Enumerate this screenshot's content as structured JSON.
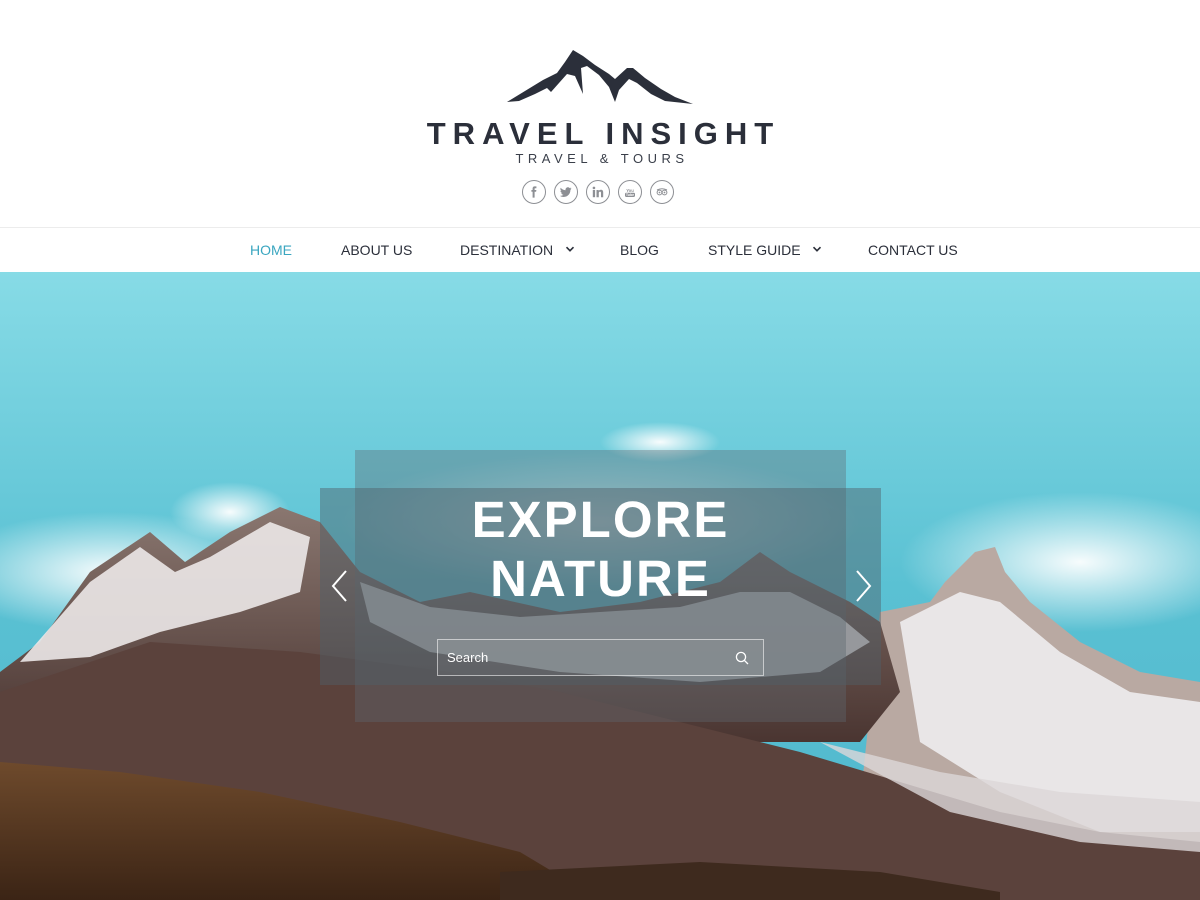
{
  "header": {
    "logo_icon": "mountain-logo",
    "title": "TRAVEL INSIGHT",
    "tagline": "TRAVEL & TOURS",
    "social": [
      {
        "name": "facebook-icon"
      },
      {
        "name": "twitter-icon"
      },
      {
        "name": "linkedin-icon"
      },
      {
        "name": "youtube-icon"
      },
      {
        "name": "tripadvisor-icon"
      }
    ]
  },
  "nav": {
    "items": [
      {
        "label": "HOME",
        "active": true
      },
      {
        "label": "ABOUT US"
      },
      {
        "label": "DESTINATION",
        "dropdown": true
      },
      {
        "label": "BLOG"
      },
      {
        "label": "STYLE GUIDE",
        "dropdown": true
      },
      {
        "label": "CONTACT US"
      }
    ]
  },
  "hero": {
    "title_line1": "EXPLORE",
    "title_line2": "NATURE",
    "search_placeholder": "Search",
    "prev_icon": "chevron-left-icon",
    "next_icon": "chevron-right-icon"
  },
  "colors": {
    "accent": "#3aa6c0",
    "text": "#2b2f3a",
    "sky": "#5cc3d3"
  }
}
